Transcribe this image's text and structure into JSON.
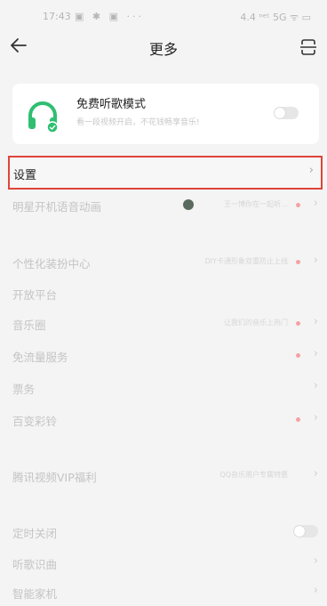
{
  "status_bar": {
    "time": "17:43",
    "indicators": "▣ ✱ ▣ ···",
    "right": "4.4 ⁿᵉᵗ 5G ᯤ ▭"
  },
  "header": {
    "title": "更多"
  },
  "free_mode": {
    "title": "免费听歌模式",
    "subtitle": "看一段视频开启，不花钱畅享音乐!"
  },
  "settings": {
    "label": "设置"
  },
  "rows": [
    {
      "label": "明星开机语音动画",
      "hint": "王一博你在一起听…"
    },
    {
      "label": "个性化装扮中心",
      "hint": "DIY卡通形象双重防止上线"
    },
    {
      "label": "开放平台"
    },
    {
      "label": "音乐圈",
      "hint": "让我们的音乐上热门"
    },
    {
      "label": "免流量服务"
    },
    {
      "label": "票务"
    },
    {
      "label": "百变彩铃"
    },
    {
      "label": "腾讯视频VIP福利",
      "hint": "QQ音乐用户专属特惠"
    },
    {
      "label": "定时关闭"
    },
    {
      "label": "听歌识曲"
    },
    {
      "label": "智能家机"
    }
  ],
  "colors": {
    "accent": "#2fbf71",
    "highlight": "#e0443a"
  }
}
